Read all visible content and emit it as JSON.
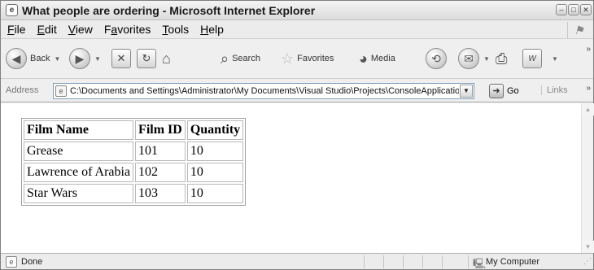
{
  "window": {
    "title": "What people are ordering - Microsoft Internet Explorer",
    "app_icon": "ie-page-icon",
    "minimize_glyph": "–",
    "maximize_glyph": "□",
    "close_glyph": "✕"
  },
  "menu": {
    "items": [
      {
        "accel": "F",
        "rest": "ile"
      },
      {
        "accel": "E",
        "rest": "dit"
      },
      {
        "accel": "V",
        "rest": "iew"
      },
      {
        "pre": "F",
        "accel": "a",
        "rest": "vorites"
      },
      {
        "accel": "T",
        "rest": "ools"
      },
      {
        "accel": "H",
        "rest": "elp"
      }
    ]
  },
  "toolbar": {
    "back_label": "Back",
    "search_label": "Search",
    "favorites_label": "Favorites",
    "media_label": "Media"
  },
  "address": {
    "label": "Address",
    "value": "C:\\Documents and Settings\\Administrator\\My Documents\\Visual Studio\\Projects\\ConsoleApplicatior",
    "go_label": "Go",
    "links_label": "Links"
  },
  "table": {
    "headers": [
      "Film Name",
      "Film ID",
      "Quantity"
    ],
    "rows": [
      [
        "Grease",
        "101",
        "10"
      ],
      [
        "Lawrence of Arabia",
        "102",
        "10"
      ],
      [
        "Star Wars",
        "103",
        "10"
      ]
    ]
  },
  "status": {
    "text": "Done",
    "zone": "My Computer"
  }
}
